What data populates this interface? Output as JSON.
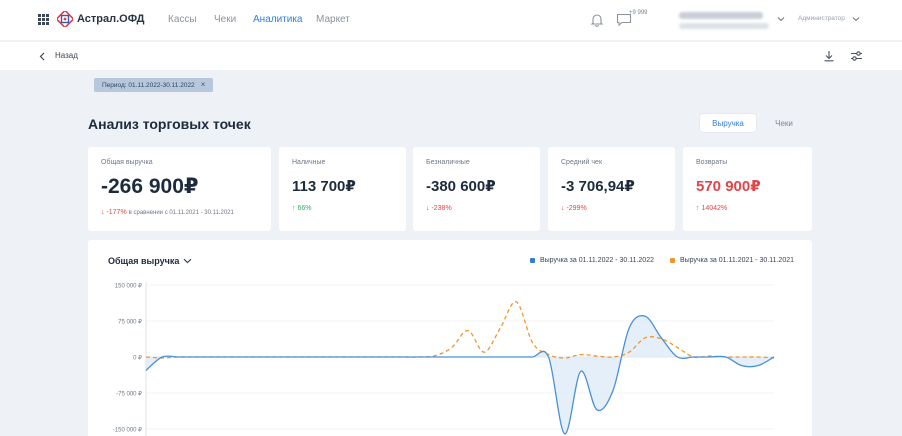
{
  "header": {
    "brand": "Астрал.ОФД",
    "nav": [
      {
        "label": "Кассы",
        "active": false
      },
      {
        "label": "Чеки",
        "active": false
      },
      {
        "label": "Аналитика",
        "active": true
      },
      {
        "label": "Маркет",
        "active": false
      }
    ],
    "chat_badge": "+9 999",
    "role": "Администратор"
  },
  "subbar": {
    "back_label": "Назад"
  },
  "filter": {
    "period_chip": "Период: 01.11.2022-30.11.2022",
    "close": "×"
  },
  "page": {
    "title": "Анализ торговых точек",
    "toggle": [
      {
        "label": "Выручка",
        "active": true
      },
      {
        "label": "Чеки",
        "active": false
      }
    ]
  },
  "cards": [
    {
      "label": "Общая выручка",
      "value": "-266 900₽",
      "delta": "↓ -177%",
      "delta_dir": "neg",
      "compare": "в сравнении с 01.11.2021 - 30.11.2021"
    },
    {
      "label": "Наличные",
      "value": "113 700₽",
      "delta": "↑ 66%",
      "delta_dir": "pos"
    },
    {
      "label": "Безналичные",
      "value": "-380 600₽",
      "delta": "↓ -238%",
      "delta_dir": "neg"
    },
    {
      "label": "Средний чек",
      "value": "-3 706,94₽",
      "delta": "↓ -299%",
      "delta_dir": "neg"
    },
    {
      "label": "Возвраты",
      "value": "570 900₽",
      "delta": "↑ 14042%",
      "delta_dir": "pos",
      "value_color": "red"
    }
  ],
  "chart": {
    "selector_label": "Общая выручка",
    "colors": {
      "current": "#4a90d9",
      "previous": "#f0962e",
      "fill": "#d9e8f7"
    }
  },
  "chart_data": {
    "type": "line",
    "ylim": [
      -150000,
      150000
    ],
    "yticks": [
      "150 000 ₽",
      "75 000 ₽",
      "0 ₽",
      "-75 000 ₽",
      "-150 000 ₽"
    ],
    "ytick_values": [
      150000,
      75000,
      0,
      -75000,
      -150000
    ],
    "series": [
      {
        "name": "Выручка за 01.11.2022 - 30.11.2022",
        "color": "#4a90d9",
        "values": [
          -28000,
          0,
          0,
          0,
          0,
          0,
          0,
          0,
          0,
          0,
          0,
          0,
          0,
          0,
          0,
          0,
          0,
          0,
          0,
          0,
          0,
          0,
          0,
          0,
          0,
          0,
          -160000,
          -30000,
          -110000,
          -70000,
          60000,
          85000,
          40000,
          0,
          0,
          0,
          0,
          -18000,
          -18000,
          0
        ]
      },
      {
        "name": "Выручка за 01.11.2021 - 30.11.2021",
        "color": "#f0962e",
        "values": [
          0,
          -2000,
          0,
          0,
          0,
          0,
          0,
          0,
          0,
          0,
          0,
          0,
          0,
          0,
          0,
          0,
          0,
          0,
          3000,
          20000,
          55000,
          10000,
          60000,
          115000,
          30000,
          5000,
          -2000,
          5000,
          2000,
          0,
          10000,
          40000,
          38000,
          20000,
          0,
          2000,
          0,
          0,
          0,
          -2000
        ]
      }
    ]
  }
}
